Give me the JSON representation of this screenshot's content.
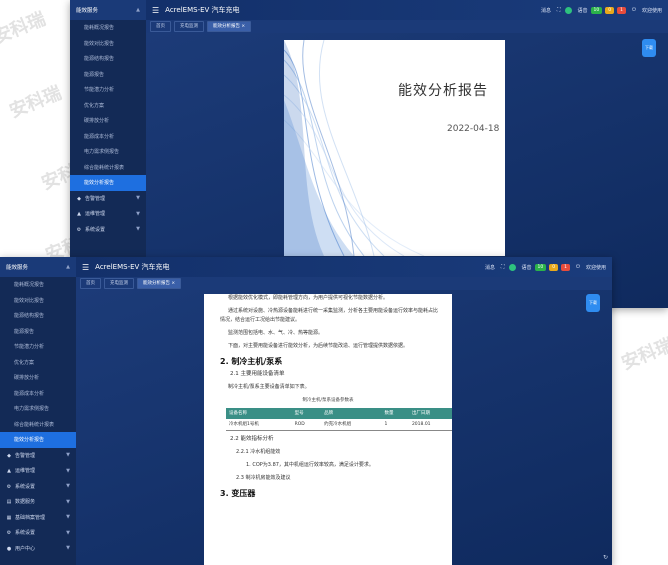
{
  "watermark": "安科瑞",
  "window_top": {
    "sidebar": {
      "group_title": "能效服务",
      "items": [
        "能耗概况报告",
        "能效对比报告",
        "能源结构报告",
        "能源报告",
        "节能潜力分析",
        "优化方案",
        "碳排放分析",
        "能源成本分析",
        "电力需求侧报告",
        "综合能耗统计报表",
        "能效分析报告"
      ],
      "active_index": 10,
      "groups": [
        {
          "label": "告警管理",
          "icon": "bell-icon"
        },
        {
          "label": "运维管理",
          "icon": "wrench-icon"
        },
        {
          "label": "系统设置",
          "icon": "gear-icon"
        }
      ]
    },
    "header": {
      "title": "AcrelEMS-EV 汽车充电",
      "items": [
        "消息",
        "全屏",
        "语音"
      ],
      "badges": [
        {
          "text": "10",
          "color": "#2bb34a"
        },
        {
          "text": "0",
          "color": "#e8a91b"
        },
        {
          "text": "1",
          "color": "#e74c3c"
        }
      ],
      "user": "欢迎使用"
    },
    "tabs": [
      {
        "label": "首页"
      },
      {
        "label": "充电监测"
      },
      {
        "label": "能效分析报告 ×"
      }
    ],
    "active_tab": 2,
    "fab_label": "下载",
    "document": {
      "title": "能效分析报告",
      "date": "2022-04-18"
    }
  },
  "window_bottom": {
    "sidebar": {
      "group_title": "能效服务",
      "items": [
        "能耗概况报告",
        "能效对比报告",
        "能源结构报告",
        "能源报告",
        "节能潜力分析",
        "优化方案",
        "碳排放分析",
        "能源成本分析",
        "电力需求侧报告",
        "综合能耗统计报表",
        "能效分析报告"
      ],
      "active_index": 10,
      "groups": [
        {
          "label": "告警管理",
          "icon": "bell-icon"
        },
        {
          "label": "运维管理",
          "icon": "wrench-icon"
        },
        {
          "label": "系统设置",
          "icon": "gear-icon"
        },
        {
          "label": "数据服务",
          "icon": "database-icon"
        },
        {
          "label": "基础档案管理",
          "icon": "folder-icon"
        },
        {
          "label": "系统设置",
          "icon": "gear-icon"
        },
        {
          "label": "用户中心",
          "icon": "user-icon"
        }
      ]
    },
    "header": {
      "title": "AcrelEMS-EV 汽车充电",
      "items": [
        "消息",
        "全屏",
        "语音"
      ],
      "badges": [
        {
          "text": "10",
          "color": "#2bb34a"
        },
        {
          "text": "0",
          "color": "#e8a91b"
        },
        {
          "text": "1",
          "color": "#e74c3c"
        }
      ],
      "user": "欢迎使用"
    },
    "tabs": [
      {
        "label": "首页"
      },
      {
        "label": "充电监测"
      },
      {
        "label": "能效分析报告 ×"
      }
    ],
    "active_tab": 2,
    "fab_label": "下载",
    "document": {
      "paragraphs": [
        "根据能效优化模式，即能耗管理方向，为用户提供可视化节能数据分析。",
        "通过系统对设施、冷热源设备能耗进行统一采集监测，分析各主要用能设备运行效率与能耗占比情况，结合运行工况给出节能建议。",
        "监测范围包括电、水、气、冷、热等能源。",
        "下面，对主要用能设备进行能效分析，为后续节能改造、运行管理提供数据依据。"
      ],
      "section_1": "2. 制冷主机/泵系",
      "sub_1": "2.1 主要用能设备清单",
      "sub_1_text": "制冷主机/泵系主要设备清单如下表。",
      "table_caption": "制冷主机/泵系设备参数表",
      "table_headers": [
        "设备名称",
        "型号",
        "品牌",
        "数量",
        "出厂日期"
      ],
      "table_rows": [
        [
          "冷水机组1号机",
          "ROD",
          "约克冷水机组",
          "1",
          "2018.01"
        ]
      ],
      "sub_2": "2.2 能效指标分析",
      "sub_2_1": "2.2.1 冷水机组能效",
      "sub_2_1_text": "1. COP为3.87，其中机组运行效率较高，满足设计要求。",
      "sub_2_2": "2.3 制冷机房能效及建议",
      "section_2": "3. 变压器"
    }
  }
}
